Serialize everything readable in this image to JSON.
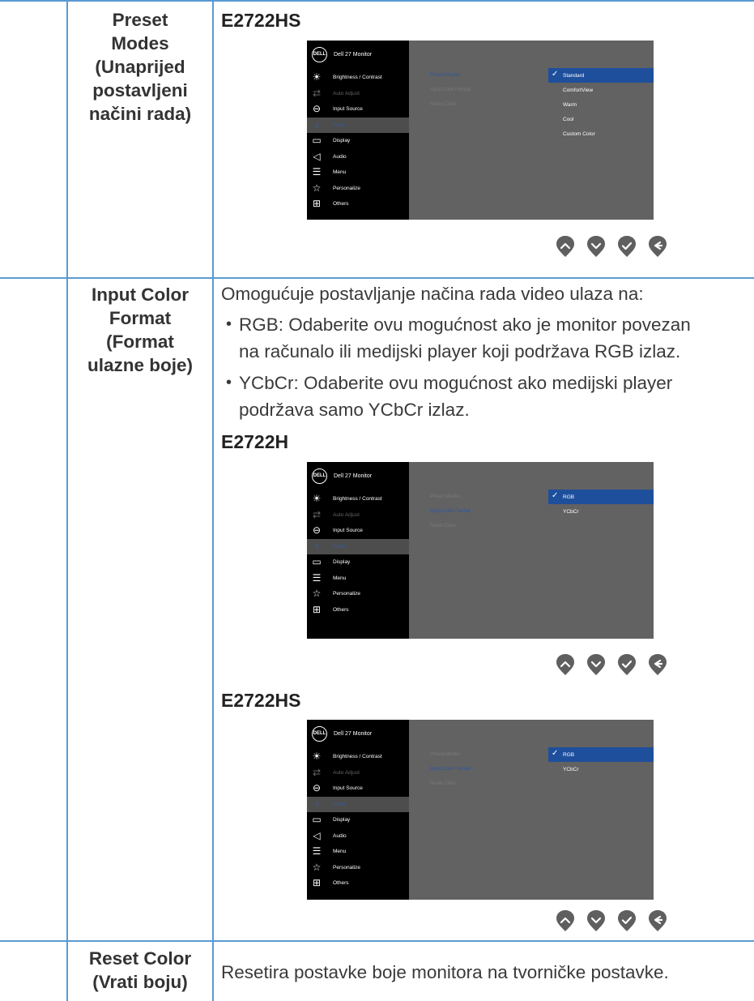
{
  "rows": [
    {
      "label_lines": [
        "Preset",
        "Modes",
        "(Unaprijed",
        "postavljeni",
        "načini rada)"
      ],
      "model": "E2722HS",
      "osd": {
        "title": "Dell 27 Monitor",
        "items": [
          {
            "icon": "brightness-icon",
            "glyph": "☀",
            "label": "Brightness / Contrast",
            "state": "normal"
          },
          {
            "icon": "auto-adjust-icon",
            "glyph": "⇄",
            "label": "Auto Adjust",
            "state": "dim"
          },
          {
            "icon": "input-source-icon",
            "glyph": "⊖",
            "label": "Input Source",
            "state": "normal"
          },
          {
            "icon": "color-icon",
            "glyph": "♁",
            "label": "Color",
            "state": "active"
          },
          {
            "icon": "display-icon",
            "glyph": "▭",
            "label": "Display",
            "state": "normal"
          },
          {
            "icon": "audio-icon",
            "glyph": "◁",
            "label": "Audio",
            "state": "normal"
          },
          {
            "icon": "menu-icon",
            "glyph": "☰",
            "label": "Menu",
            "state": "normal"
          },
          {
            "icon": "personalize-icon",
            "glyph": "☆",
            "label": "Personalize",
            "state": "normal"
          },
          {
            "icon": "others-icon",
            "glyph": "⊞",
            "label": "Others",
            "state": "normal"
          }
        ],
        "submenu": [
          "Preset Modes",
          "Input Color Format",
          "Reset Color"
        ],
        "submenu_selected": 0,
        "options": [
          "Standard",
          "ComfortView",
          "Warm",
          "Cool",
          "Custom Color"
        ],
        "option_selected": 0
      }
    },
    {
      "label_lines": [
        "Input Color",
        "Format",
        "(Format",
        "ulazne boje)"
      ],
      "intro": "Omogućuje postavljanje načina rada video ulaza na:",
      "bullets": [
        {
          "key": "RGB:",
          "lines": [
            " Odaberite ovu mogućnost ako je monitor povezan",
            "na računalo ili medijski player koji podržava RGB izlaz."
          ]
        },
        {
          "key": "YCbCr:",
          "lines": [
            " Odaberite ovu mogućnost ako medijski player",
            "podržava samo YCbCr izlaz."
          ]
        }
      ],
      "osd_a": {
        "model": "E2722H",
        "title": "Dell 27 Monitor",
        "items": [
          {
            "icon": "brightness-icon",
            "glyph": "☀",
            "label": "Brightness / Contrast",
            "state": "normal"
          },
          {
            "icon": "auto-adjust-icon",
            "glyph": "⇄",
            "label": "Auto Adjust",
            "state": "dim"
          },
          {
            "icon": "input-source-icon",
            "glyph": "⊖",
            "label": "Input Source",
            "state": "normal"
          },
          {
            "icon": "color-icon",
            "glyph": "♁",
            "label": "Color",
            "state": "active"
          },
          {
            "icon": "display-icon",
            "glyph": "▭",
            "label": "Display",
            "state": "normal"
          },
          {
            "icon": "menu-icon",
            "glyph": "☰",
            "label": "Menu",
            "state": "normal"
          },
          {
            "icon": "personalize-icon",
            "glyph": "☆",
            "label": "Personalize",
            "state": "normal"
          },
          {
            "icon": "others-icon",
            "glyph": "⊞",
            "label": "Others",
            "state": "normal"
          }
        ],
        "submenu": [
          "Preset Modes",
          "Input Color Format",
          "Reset Color"
        ],
        "submenu_selected": 1,
        "options": [
          "RGB",
          "YCbCr"
        ],
        "option_selected": 0
      },
      "osd_b": {
        "model": "E2722HS",
        "title": "Dell 27 Monitor",
        "items": [
          {
            "icon": "brightness-icon",
            "glyph": "☀",
            "label": "Brightness / Contrast",
            "state": "normal"
          },
          {
            "icon": "auto-adjust-icon",
            "glyph": "⇄",
            "label": "Auto Adjust",
            "state": "dim"
          },
          {
            "icon": "input-source-icon",
            "glyph": "⊖",
            "label": "Input Source",
            "state": "normal"
          },
          {
            "icon": "color-icon",
            "glyph": "♁",
            "label": "Color",
            "state": "active"
          },
          {
            "icon": "display-icon",
            "glyph": "▭",
            "label": "Display",
            "state": "normal"
          },
          {
            "icon": "audio-icon",
            "glyph": "◁",
            "label": "Audio",
            "state": "normal"
          },
          {
            "icon": "menu-icon",
            "glyph": "☰",
            "label": "Menu",
            "state": "normal"
          },
          {
            "icon": "personalize-icon",
            "glyph": "☆",
            "label": "Personalize",
            "state": "normal"
          },
          {
            "icon": "others-icon",
            "glyph": "⊞",
            "label": "Others",
            "state": "normal"
          }
        ],
        "submenu": [
          "Preset Modes",
          "Input Color Format",
          "Reset Color"
        ],
        "submenu_selected": 1,
        "options": [
          "RGB",
          "YCbCr"
        ],
        "option_selected": 0
      }
    },
    {
      "label_lines": [
        "Reset Color",
        "(Vrati boju)"
      ],
      "text": "Resetira postavke boje monitora na tvorničke postavke."
    }
  ],
  "nav_buttons": [
    "up-button",
    "down-button",
    "ok-button",
    "back-button"
  ],
  "colors": {
    "rule": "#5a9bd3",
    "osd_panel": "#626262",
    "osd_sidebar": "#000000",
    "highlight": "#1e4f9c",
    "nav_icon": "#5f5f5f"
  }
}
